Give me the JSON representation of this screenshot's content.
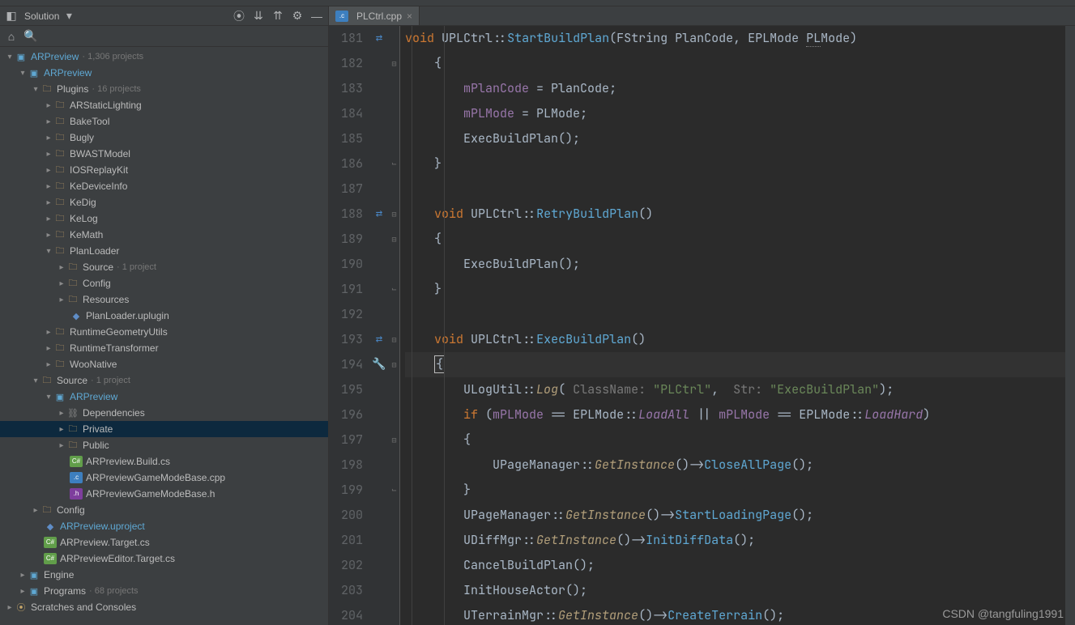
{
  "sidebar": {
    "title": "Solution",
    "search_placeholder": "",
    "root": {
      "name": "ARPreview",
      "suffix": "· 1,306 projects"
    },
    "arpreview": "ARPreview",
    "plugins": {
      "name": "Plugins",
      "suffix": "· 16 projects"
    },
    "plugin_items": [
      "ARStaticLighting",
      "BakeTool",
      "Bugly",
      "BWASTModel",
      "IOSReplayKit",
      "KeDeviceInfo",
      "KeDig",
      "KeLog",
      "KeMath"
    ],
    "planloader": "PlanLoader",
    "planloader_source": {
      "name": "Source",
      "suffix": "· 1 project"
    },
    "planloader_config": "Config",
    "planloader_resources": "Resources",
    "planloader_uplugin": "PlanLoader.uplugin",
    "plugin_tail": [
      "RuntimeGeometryUtils",
      "RuntimeTransformer",
      "WooNative"
    ],
    "source": {
      "name": "Source",
      "suffix": "· 1 project"
    },
    "src_arpreview": "ARPreview",
    "dependencies": "Dependencies",
    "private": "Private",
    "public": "Public",
    "buildcs": "ARPreview.Build.cs",
    "gamemode_cpp": "ARPreviewGameModeBase.cpp",
    "gamemode_h": "ARPreviewGameModeBase.h",
    "config": "Config",
    "uproject": "ARPreview.uproject",
    "target_cs": "ARPreview.Target.cs",
    "editor_target_cs": "ARPreviewEditor.Target.cs",
    "engine": "Engine",
    "programs": {
      "name": "Programs",
      "suffix": "· 68 projects"
    },
    "scratches": "Scratches and Consoles"
  },
  "tab": {
    "title": "PLCtrl.cpp"
  },
  "line_numbers": [
    "181",
    "182",
    "183",
    "184",
    "185",
    "186",
    "187",
    "188",
    "189",
    "190",
    "191",
    "192",
    "193",
    "194",
    "195",
    "196",
    "197",
    "198",
    "199",
    "200",
    "201",
    "202",
    "203",
    "204"
  ],
  "code": {
    "l181": {
      "kw": "void",
      "cls": "UPLCtrl",
      "fn": "StartBuildPlan",
      "params_raw": "(FString PlanCode, EPLMode ",
      "pl": "PL",
      "mode": "Mode)"
    },
    "l182": "{",
    "l183": {
      "lhs": "mPlanCode",
      "rhs": "PlanCode"
    },
    "l184": {
      "lhs": "mPLMode",
      "rhs": "PLMode"
    },
    "l185": "ExecBuildPlan",
    "l185p": "();",
    "l186": "}",
    "l188": {
      "kw": "void",
      "cls": "UPLCtrl",
      "fn": "RetryBuildPlan",
      "p": "()"
    },
    "l189": "{",
    "l190": "ExecBuildPlan",
    "l190p": "();",
    "l191": "}",
    "l193": {
      "kw": "void",
      "cls": "UPLCtrl",
      "fn": "ExecBuildPlan",
      "p": "()"
    },
    "l194": "{",
    "l195": {
      "cls": "ULogUtil",
      "fn": "Log",
      "h1": "ClassName:",
      "s1": "\"PLCtrl\"",
      "h2": "Str:",
      "s2": "\"ExecBuildPlan\""
    },
    "l196": {
      "if": "if",
      "m": "mPLMode",
      "en": "EPLMode",
      "c1": "LoadAll",
      "or": "||",
      "c2": "LoadHard"
    },
    "l197": "{",
    "l198": {
      "cls": "UPageManager",
      "gi": "GetInstance",
      "call": "CloseAllPage"
    },
    "l199": "}",
    "l200": {
      "cls": "UPageManager",
      "gi": "GetInstance",
      "call": "StartLoadingPage"
    },
    "l201": {
      "cls": "UDiffMgr",
      "gi": "GetInstance",
      "call": "InitDiffData"
    },
    "l202": {
      "fn": "CancelBuildPlan"
    },
    "l203": {
      "fn": "InitHouseActor"
    },
    "l204": {
      "cls": "UTerrainMgr",
      "gi": "GetInstance",
      "call": "CreateTerrain"
    }
  },
  "watermark": "CSDN @tangfuling1991"
}
